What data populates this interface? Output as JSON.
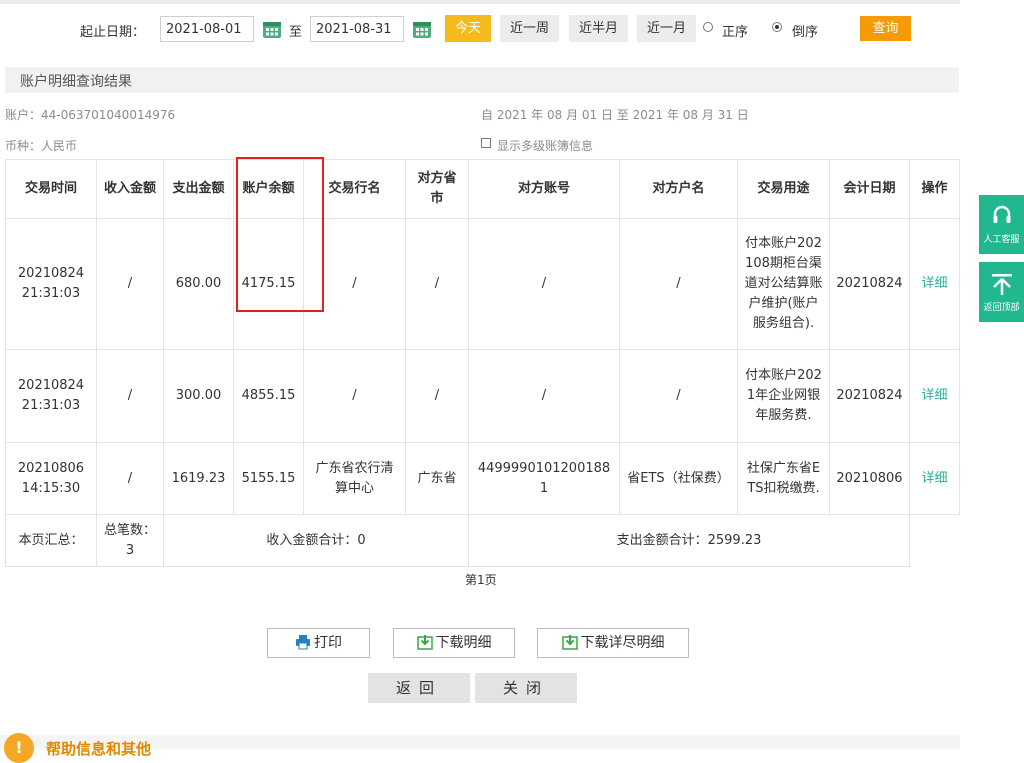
{
  "filter": {
    "label": "起止日期：",
    "start_date": "2021-08-01",
    "to": "至",
    "end_date": "2021-08-31",
    "today": "今天",
    "week": "近一周",
    "half_month": "近半月",
    "month": "近一月",
    "asc": "正序",
    "desc": "倒序",
    "query": "查询"
  },
  "section_title": "账户明细查询结果",
  "account": {
    "number": "账户：44-063701040014976",
    "period": "自 2021 年 08 月 01 日 至 2021 年 08 月 31 日",
    "currency": "币种：人民币",
    "multi_level": "显示多级账簿信息"
  },
  "table": {
    "headers": [
      "交易时间",
      "收入金额",
      "支出金额",
      "账户余额",
      "交易行名",
      "对方省市",
      "对方账号",
      "对方户名",
      "交易用途",
      "会计日期",
      "操作"
    ],
    "rows": [
      {
        "time": "20210824 21:31:03",
        "income": "/",
        "expense": "680.00",
        "balance": "4175.15",
        "bank": "/",
        "province": "/",
        "account": "/",
        "name": "/",
        "purpose": "付本账户202108期柜台渠道对公结算账户维护(账户服务组合).",
        "date": "20210824",
        "op": "详细"
      },
      {
        "time": "20210824 21:31:03",
        "income": "/",
        "expense": "300.00",
        "balance": "4855.15",
        "bank": "/",
        "province": "/",
        "account": "/",
        "name": "/",
        "purpose": "付本账户2021年企业网银年服务费.",
        "date": "20210824",
        "op": "详细"
      },
      {
        "time": "20210806 14:15:30",
        "income": "/",
        "expense": "1619.23",
        "balance": "5155.15",
        "bank": "广东省农行清算中心",
        "province": "广东省",
        "account": "44999901012001881",
        "name": "省ETS（社保费）",
        "purpose": "社保广东省ETS扣税缴费.",
        "date": "20210806",
        "op": "详细"
      }
    ],
    "summary": {
      "label": "本页汇总：",
      "count": "总笔数：3",
      "income_total": "收入金额合计：0",
      "expense_total": "支出金额合计：2599.23"
    }
  },
  "page": "第1页",
  "actions": {
    "print": "打印",
    "download": "下载明细",
    "download_full": "下载详尽明细",
    "back": "返回",
    "close": "关闭"
  },
  "help": "帮助信息和其他",
  "side": {
    "service": "人工客服",
    "top": "返回顶部"
  },
  "colors": {
    "accent_orange": "#f69a06",
    "today_yellow": "#f5bb1c",
    "link_teal": "#2bb09b",
    "side_green": "#21b78f",
    "highlight_red": "#e02020"
  }
}
